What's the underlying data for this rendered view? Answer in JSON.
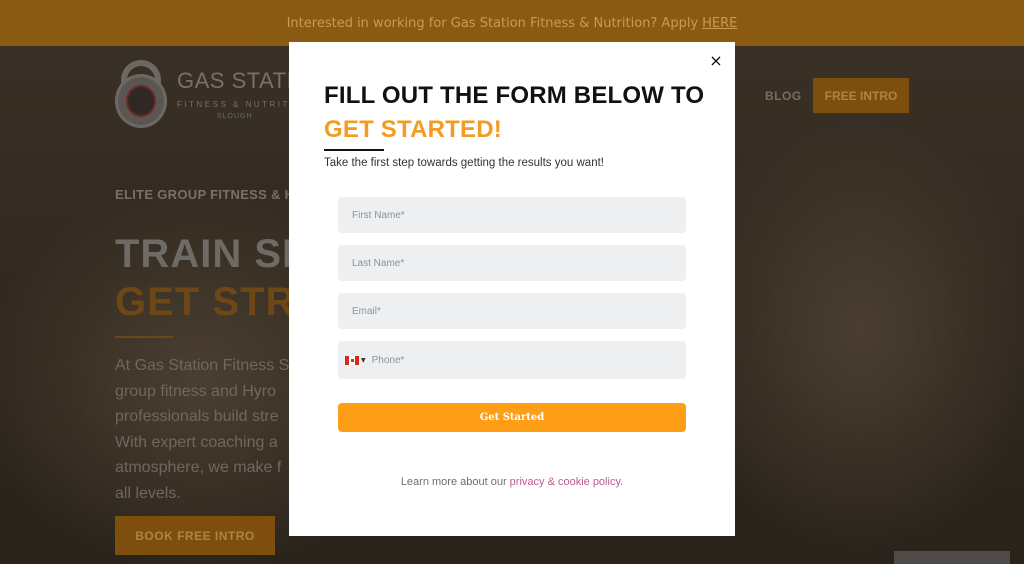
{
  "announcement": {
    "text": "Interested in working for Gas Station Fitness & Nutrition? Apply",
    "link": "HERE"
  },
  "logo": {
    "name": "GAS STATION",
    "tagline": "FITNESS & NUTRITION",
    "city": "SLOUGH"
  },
  "nav": {
    "blog": "BLOG",
    "cta": "FREE INTRO"
  },
  "hero": {
    "eyebrow": "ELITE GROUP FITNESS & H",
    "line1": "TRAIN SI",
    "line2": "GET STRO",
    "paragraph": [
      "At Gas Station Fitness S",
      "group fitness and Hyro",
      "professionals build stre",
      "With expert coaching a",
      "atmosphere, we make f",
      "all levels."
    ],
    "button": "BOOK FREE INTRO"
  },
  "modal": {
    "close": "×",
    "title_line1": "FILL OUT THE FORM BELOW TO",
    "title_line2": "GET STARTED!",
    "subtitle": "Take the first step towards getting the results you want!",
    "fields": {
      "first_name": "First Name*",
      "last_name": "Last Name*",
      "email": "Email*",
      "phone": "Phone*"
    },
    "submit": "Get Started",
    "footer_text": "Learn more about our",
    "footer_link": "privacy & cookie policy."
  },
  "colors": {
    "accent": "#f29c24",
    "button": "#fd9e16",
    "link": "#c15a94"
  }
}
